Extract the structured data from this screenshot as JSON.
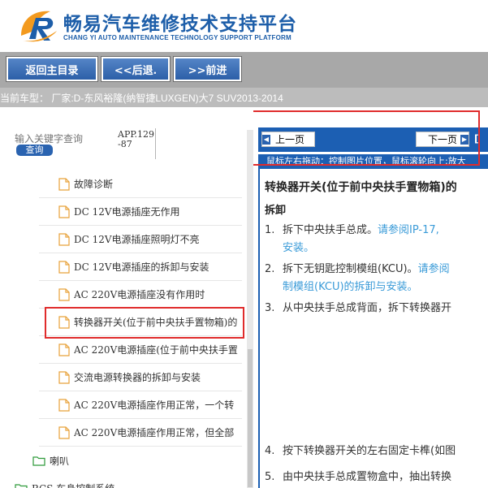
{
  "header": {
    "title": "畅易汽车维修技术支持平台",
    "subtitle": "CHANG YI AUTO MAINTENANCE TECHNOLOGY SUPPORT PLATFORM"
  },
  "nav": {
    "home_label": "返回主目录",
    "back_label": "<<后退.",
    "forward_label": ">>前进"
  },
  "car": {
    "text": "当前车型： 厂家:D-东风裕隆(纳智捷LUXGEN)大7 SUV2013-2014"
  },
  "search": {
    "placeholder": "输入关键字查询",
    "button_label": "查询",
    "app_label": "APP.129-87"
  },
  "tree": {
    "items": [
      "故障诊断",
      "DC 12V电源插座无作用",
      "DC 12V电源插座照明灯不亮",
      "DC 12V电源插座的拆卸与安装",
      "AC 220V电源插座没有作用时",
      "转换器开关(位于前中央扶手置物箱)的",
      "AC 220V电源插座(位于前中央扶手置",
      "交流电源转换器的拆卸与安装",
      "AC 220V电源插座作用正常，一个转",
      "AC 220V电源插座作用正常，但全部"
    ],
    "folder_label": "喇叭",
    "bottom_label": "BCS 车身控制系统"
  },
  "pager": {
    "prev_label": "上一页",
    "next_label": "下一页",
    "tail": "[",
    "hint": "鼠标左右拖动：控制图片位置，鼠标滚轮向上:放大"
  },
  "doc": {
    "title": "转换器开关(位于前中央扶手置物箱)的",
    "section": "拆卸",
    "steps": [
      {
        "num": "1.",
        "text": "拆下中央扶手总成。",
        "link": "请参阅IP-17,",
        "cont": "安装。"
      },
      {
        "num": "2.",
        "text": "拆下无钥匙控制模组(KCU)。",
        "link": "请参阅",
        "cont": "制模组(KCU)的拆卸与安装。"
      },
      {
        "num": "3.",
        "text": "从中央扶手总成背面，拆下转换器开"
      },
      {
        "num": "4.",
        "text": "按下转换器开关的左右固定卡榫(如图"
      },
      {
        "num": "5.",
        "text": "由中央扶手总成置物盒中，抽出转换"
      }
    ]
  },
  "colors": {
    "brand": "#1d5ea9",
    "nav_button": "#2c5fa8",
    "highlight": "#e02c2c",
    "link": "#3a9bd8"
  }
}
